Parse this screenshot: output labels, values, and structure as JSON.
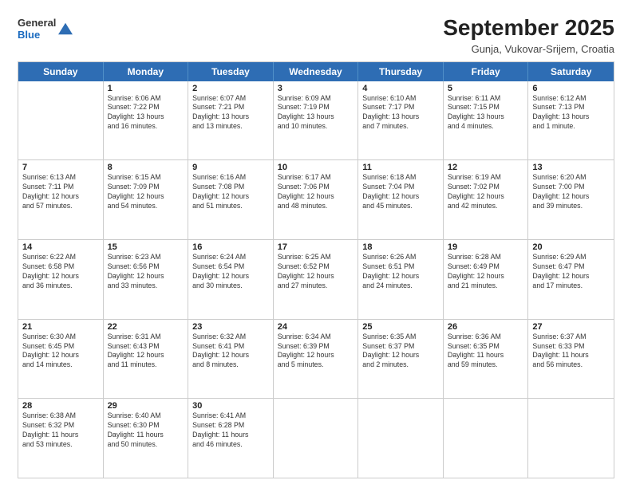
{
  "logo": {
    "general": "General",
    "blue": "Blue"
  },
  "title": "September 2025",
  "subtitle": "Gunja, Vukovar-Srijem, Croatia",
  "headers": [
    "Sunday",
    "Monday",
    "Tuesday",
    "Wednesday",
    "Thursday",
    "Friday",
    "Saturday"
  ],
  "rows": [
    [
      {
        "day": "",
        "info": ""
      },
      {
        "day": "1",
        "info": "Sunrise: 6:06 AM\nSunset: 7:22 PM\nDaylight: 13 hours\nand 16 minutes."
      },
      {
        "day": "2",
        "info": "Sunrise: 6:07 AM\nSunset: 7:21 PM\nDaylight: 13 hours\nand 13 minutes."
      },
      {
        "day": "3",
        "info": "Sunrise: 6:09 AM\nSunset: 7:19 PM\nDaylight: 13 hours\nand 10 minutes."
      },
      {
        "day": "4",
        "info": "Sunrise: 6:10 AM\nSunset: 7:17 PM\nDaylight: 13 hours\nand 7 minutes."
      },
      {
        "day": "5",
        "info": "Sunrise: 6:11 AM\nSunset: 7:15 PM\nDaylight: 13 hours\nand 4 minutes."
      },
      {
        "day": "6",
        "info": "Sunrise: 6:12 AM\nSunset: 7:13 PM\nDaylight: 13 hours\nand 1 minute."
      }
    ],
    [
      {
        "day": "7",
        "info": "Sunrise: 6:13 AM\nSunset: 7:11 PM\nDaylight: 12 hours\nand 57 minutes."
      },
      {
        "day": "8",
        "info": "Sunrise: 6:15 AM\nSunset: 7:09 PM\nDaylight: 12 hours\nand 54 minutes."
      },
      {
        "day": "9",
        "info": "Sunrise: 6:16 AM\nSunset: 7:08 PM\nDaylight: 12 hours\nand 51 minutes."
      },
      {
        "day": "10",
        "info": "Sunrise: 6:17 AM\nSunset: 7:06 PM\nDaylight: 12 hours\nand 48 minutes."
      },
      {
        "day": "11",
        "info": "Sunrise: 6:18 AM\nSunset: 7:04 PM\nDaylight: 12 hours\nand 45 minutes."
      },
      {
        "day": "12",
        "info": "Sunrise: 6:19 AM\nSunset: 7:02 PM\nDaylight: 12 hours\nand 42 minutes."
      },
      {
        "day": "13",
        "info": "Sunrise: 6:20 AM\nSunset: 7:00 PM\nDaylight: 12 hours\nand 39 minutes."
      }
    ],
    [
      {
        "day": "14",
        "info": "Sunrise: 6:22 AM\nSunset: 6:58 PM\nDaylight: 12 hours\nand 36 minutes."
      },
      {
        "day": "15",
        "info": "Sunrise: 6:23 AM\nSunset: 6:56 PM\nDaylight: 12 hours\nand 33 minutes."
      },
      {
        "day": "16",
        "info": "Sunrise: 6:24 AM\nSunset: 6:54 PM\nDaylight: 12 hours\nand 30 minutes."
      },
      {
        "day": "17",
        "info": "Sunrise: 6:25 AM\nSunset: 6:52 PM\nDaylight: 12 hours\nand 27 minutes."
      },
      {
        "day": "18",
        "info": "Sunrise: 6:26 AM\nSunset: 6:51 PM\nDaylight: 12 hours\nand 24 minutes."
      },
      {
        "day": "19",
        "info": "Sunrise: 6:28 AM\nSunset: 6:49 PM\nDaylight: 12 hours\nand 21 minutes."
      },
      {
        "day": "20",
        "info": "Sunrise: 6:29 AM\nSunset: 6:47 PM\nDaylight: 12 hours\nand 17 minutes."
      }
    ],
    [
      {
        "day": "21",
        "info": "Sunrise: 6:30 AM\nSunset: 6:45 PM\nDaylight: 12 hours\nand 14 minutes."
      },
      {
        "day": "22",
        "info": "Sunrise: 6:31 AM\nSunset: 6:43 PM\nDaylight: 12 hours\nand 11 minutes."
      },
      {
        "day": "23",
        "info": "Sunrise: 6:32 AM\nSunset: 6:41 PM\nDaylight: 12 hours\nand 8 minutes."
      },
      {
        "day": "24",
        "info": "Sunrise: 6:34 AM\nSunset: 6:39 PM\nDaylight: 12 hours\nand 5 minutes."
      },
      {
        "day": "25",
        "info": "Sunrise: 6:35 AM\nSunset: 6:37 PM\nDaylight: 12 hours\nand 2 minutes."
      },
      {
        "day": "26",
        "info": "Sunrise: 6:36 AM\nSunset: 6:35 PM\nDaylight: 11 hours\nand 59 minutes."
      },
      {
        "day": "27",
        "info": "Sunrise: 6:37 AM\nSunset: 6:33 PM\nDaylight: 11 hours\nand 56 minutes."
      }
    ],
    [
      {
        "day": "28",
        "info": "Sunrise: 6:38 AM\nSunset: 6:32 PM\nDaylight: 11 hours\nand 53 minutes."
      },
      {
        "day": "29",
        "info": "Sunrise: 6:40 AM\nSunset: 6:30 PM\nDaylight: 11 hours\nand 50 minutes."
      },
      {
        "day": "30",
        "info": "Sunrise: 6:41 AM\nSunset: 6:28 PM\nDaylight: 11 hours\nand 46 minutes."
      },
      {
        "day": "",
        "info": ""
      },
      {
        "day": "",
        "info": ""
      },
      {
        "day": "",
        "info": ""
      },
      {
        "day": "",
        "info": ""
      }
    ]
  ]
}
